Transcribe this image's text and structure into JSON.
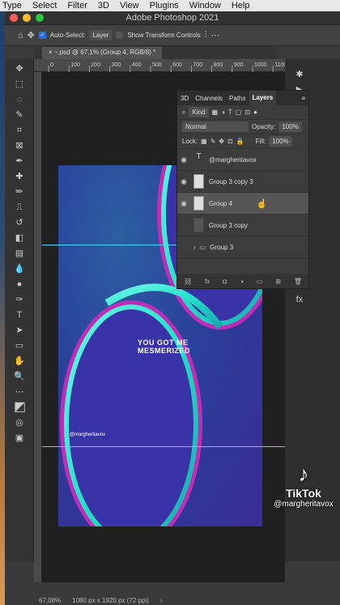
{
  "menubar": {
    "items": [
      "Type",
      "Select",
      "Filter",
      "3D",
      "View",
      "Plugins",
      "Window",
      "Help"
    ]
  },
  "window": {
    "title": "Adobe Photoshop 2021"
  },
  "options": {
    "auto_select_label": "Auto-Select:",
    "auto_select_value": "Layer",
    "show_transform_label": "Show Transform Controls"
  },
  "document_tab": {
    "label": "~.psd @ 67,1% (Group 4, RGB/8) *"
  },
  "ruler": {
    "ticks": [
      "0",
      "100",
      "200",
      "300",
      "400",
      "500",
      "600",
      "700",
      "800",
      "900",
      "1000",
      "1100"
    ]
  },
  "artwork": {
    "text_lines": [
      "YOU GOT ME",
      "MESMERIZED"
    ],
    "handle": "@margheritavox"
  },
  "layers_panel": {
    "tabs": [
      "3D",
      "Channels",
      "Paths",
      "Layers"
    ],
    "kind_label": "Kind",
    "blend_mode": "Normal",
    "opacity_label": "Opacity:",
    "opacity_value": "100%",
    "lock_label": "Lock:",
    "fill_label": "Fill:",
    "fill_value": "100%",
    "layers": [
      {
        "name": "@margheritavox",
        "type": "text",
        "visible": true
      },
      {
        "name": "Group 3 copy 3",
        "type": "layer",
        "visible": true
      },
      {
        "name": "Group 4",
        "type": "layer",
        "visible": true,
        "selected": true
      },
      {
        "name": "Group 3 copy",
        "type": "layer",
        "visible": false
      },
      {
        "name": "Group 3",
        "type": "group",
        "visible": false
      }
    ]
  },
  "status": {
    "zoom": "67,08%",
    "doc_size": "1080 px x 1920 px (72 ppi)"
  },
  "tiktok": {
    "name": "TikTok",
    "handle": "@margheritavox"
  },
  "colors": {
    "accent": "#2a6ede",
    "guide": "#4ad7ff",
    "artwork_teal": "#24e0c8",
    "artwork_purple": "#3a2c96",
    "artwork_magenta": "#c02cb8"
  }
}
